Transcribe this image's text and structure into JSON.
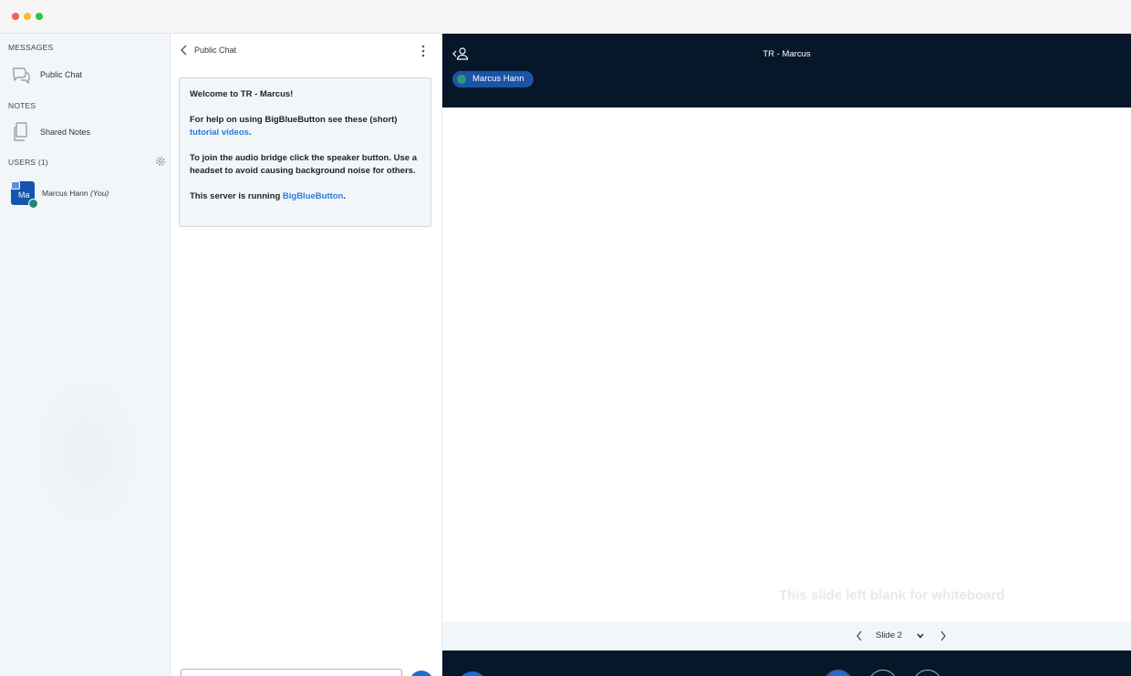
{
  "sidebar": {
    "messages_title": "MESSAGES",
    "public_chat_label": "Public Chat",
    "notes_title": "NOTES",
    "shared_notes_label": "Shared Notes",
    "users_title": "USERS (1)",
    "user": {
      "initials": "Ma",
      "name": "Marcus Hann",
      "you": "(You)"
    }
  },
  "chat": {
    "title": "Public Chat",
    "welcome": {
      "line1": "Welcome to TR - Marcus!",
      "line2_pre": "For help on using BigBlueButton see these (short)",
      "line2_link": "tutorial videos",
      "line2_post": ".",
      "line3": "To join the audio bridge click the speaker button. Use a headset to avoid causing background noise for others.",
      "line4_pre": "This server is running ",
      "line4_link": "BigBlueButton",
      "line4_post": "."
    },
    "input_placeholder": ""
  },
  "presentation": {
    "meeting_title": "TR - Marcus",
    "talker_name": "Marcus Hann",
    "slide_caption": "This slide left blank for whiteboard",
    "slide_select": "Slide 2"
  },
  "colors": {
    "dark_navy": "#06172a",
    "accent_blue": "#1a6fd0",
    "link_blue": "#2a7bde",
    "talker_blue": "#1a54a8",
    "sidebar_bg": "#f3f6f9"
  },
  "icons": {
    "public_chat": "chat-bubbles-icon",
    "shared_notes": "document-pages-icon",
    "gear": "gear-icon",
    "back": "chevron-left-icon",
    "kebab": "more-vertical-icon",
    "users_toggle": "user-toggle-icon",
    "prev": "chevron-left-icon",
    "next": "chevron-right-icon",
    "dropdown": "chevron-down-icon"
  }
}
